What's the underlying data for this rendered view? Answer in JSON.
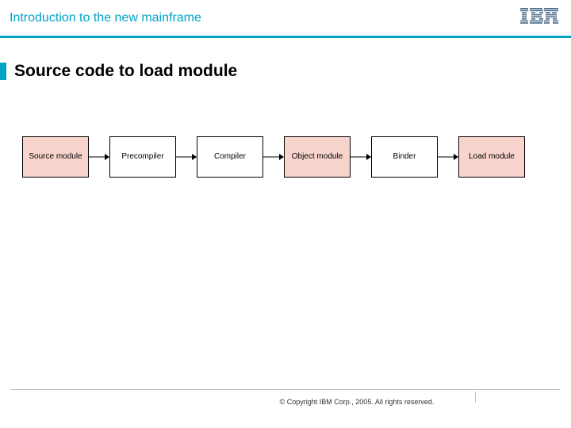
{
  "header": {
    "title": "Introduction to the new mainframe",
    "logo_name": "ibm-logo"
  },
  "slide": {
    "title": "Source code to load module"
  },
  "diagram": {
    "boxes": [
      {
        "label": "Source module",
        "style": "pink"
      },
      {
        "label": "Precompiler",
        "style": "white"
      },
      {
        "label": "Compiler",
        "style": "white"
      },
      {
        "label": "Object module",
        "style": "pink"
      },
      {
        "label": "Binder",
        "style": "white"
      },
      {
        "label": "Load module",
        "style": "pink"
      }
    ]
  },
  "footer": {
    "copyright": "© Copyright IBM Corp., 2005. All rights reserved."
  }
}
